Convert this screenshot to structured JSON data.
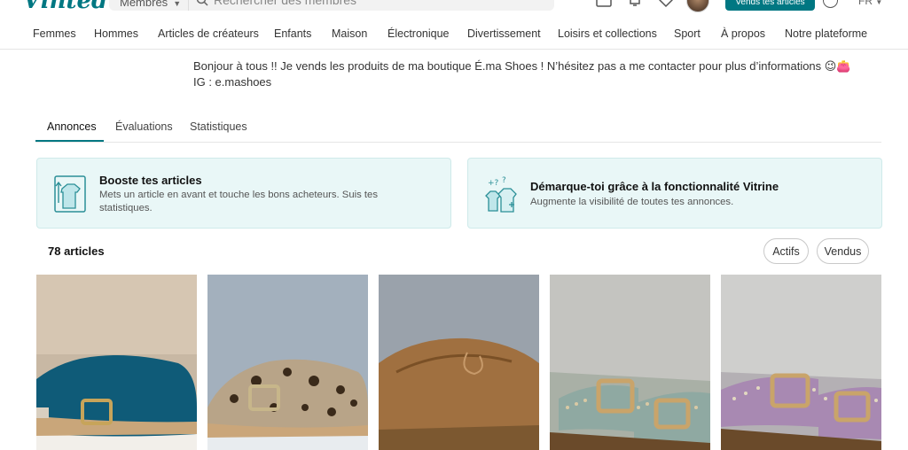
{
  "header": {
    "logo_text": "Vinted",
    "search_scope": "Membres",
    "search_placeholder": "Rechercher des membres",
    "sell_button": "Vends tes articles",
    "language": "FR"
  },
  "categories": [
    "Femmes",
    "Hommes",
    "Articles de créateurs",
    "Enfants",
    "Maison",
    "Électronique",
    "Divertissement",
    "Loisirs et collections",
    "Sport",
    "À propos",
    "Notre plateforme"
  ],
  "bio": {
    "line1": "Bonjour à tous !! Je vends les produits de ma boutique É.ma Shoes ! N’hésitez pas a me contacter pour plus d’informations 😉👛",
    "line2": "IG : e.mashoes"
  },
  "tabs": [
    "Annonces",
    "Évaluations",
    "Statistiques"
  ],
  "promos": [
    {
      "title": "Booste tes articles",
      "text": "Mets un article en avant et touche les bons acheteurs. Suis tes statistiques."
    },
    {
      "title": "Démarque-toi grâce à la fonctionnalité Vitrine",
      "text": "Augmente la visibilité de toutes tes annonces."
    }
  ],
  "listing": {
    "count_label": "78 articles",
    "filter_active": "Actifs",
    "filter_sold": "Vendus"
  },
  "colors": {
    "brand": "#007782",
    "promo_bg": "#e9f7f7"
  },
  "products": [
    {
      "name": "blue-suede-clog"
    },
    {
      "name": "leopard-clog"
    },
    {
      "name": "tan-moccasin"
    },
    {
      "name": "mint-buckle-sandal"
    },
    {
      "name": "lilac-buckle-sandal"
    }
  ]
}
